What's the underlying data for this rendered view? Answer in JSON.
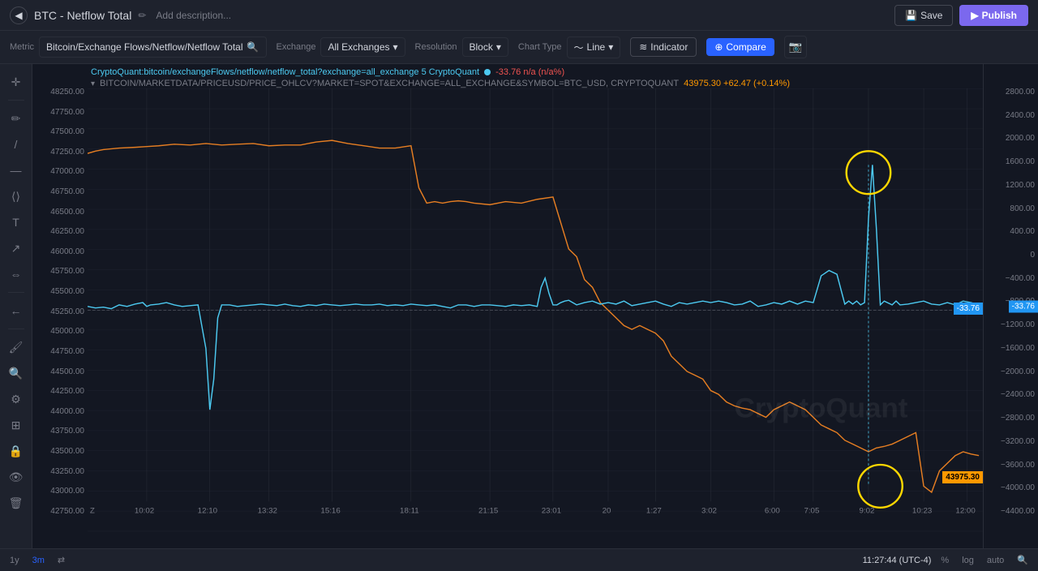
{
  "topbar": {
    "back_icon": "◀",
    "title": "BTC - Netflow Total",
    "edit_icon": "✏",
    "add_description": "Add description...",
    "save_label": "Save",
    "publish_label": "Publish"
  },
  "toolbar": {
    "metric_label": "Metric",
    "metric_value": "Bitcoin/Exchange Flows/Netflow/Netflow Total",
    "exchange_label": "Exchange",
    "exchange_value": "All Exchanges",
    "resolution_label": "Resolution",
    "resolution_value": "Block",
    "chart_type_label": "Chart Type",
    "chart_type_value": "Line",
    "indicator_label": "Indicator",
    "compare_label": "Compare"
  },
  "chart": {
    "info_line1": "CryptoQuant:bitcoin/exchangeFlows/netflow/netflow_total?exchange=all_exchange  5  CryptoQuant",
    "info_val1": "-33.76  n/a (n/a%)",
    "info_line2": "BITCOIN/MARKETDATA/PRICEUSD/PRICE_OHLCV?MARKET=SPOT&EXCHANGE=ALL_EXCHANGE&SYMBOL=BTC_USD, CRYPTOQUANT",
    "price_val": "43975.30  +62.47 (+0.14%)",
    "price_badge": "43975.30",
    "netflow_badge": "-33.76",
    "y_labels_right": [
      "2800.00",
      "2400.00",
      "2000.00",
      "1600.00",
      "1200.00",
      "800.00",
      "400.00",
      "0",
      "−400.00",
      "−800.00",
      "−1200.00",
      "−1600.00",
      "−2000.00",
      "−2400.00",
      "−2800.00",
      "−3200.00",
      "−3600.00",
      "−4000.00",
      "−4400.00"
    ],
    "y_labels_left": [
      "48250.00",
      "47750.00",
      "47500.00",
      "47250.00",
      "47000.00",
      "46750.00",
      "46500.00",
      "46250.00",
      "46000.00",
      "45750.00",
      "45500.00",
      "45250.00",
      "45000.00",
      "44750.00",
      "44500.00",
      "44250.00",
      "44000.00",
      "43750.00",
      "43500.00",
      "43250.00",
      "43000.00",
      "42750.00"
    ],
    "x_labels": [
      "10:02",
      "12:10",
      "13:32",
      "15:16",
      "18:11",
      "21:15",
      "23:01",
      "20",
      "1:27",
      "3:02",
      "6:00",
      "7:05",
      "9:02",
      "10:23",
      "12:00"
    ],
    "watermark": "CryptoQuant"
  },
  "bottom": {
    "period_1y": "1y",
    "period_3m": "3m",
    "compare_icon": "⇄",
    "timestamp": "11:27:44 (UTC-4)",
    "pct_label": "%",
    "log_label": "log",
    "auto_label": "auto",
    "zoom_icon": "🔍"
  }
}
